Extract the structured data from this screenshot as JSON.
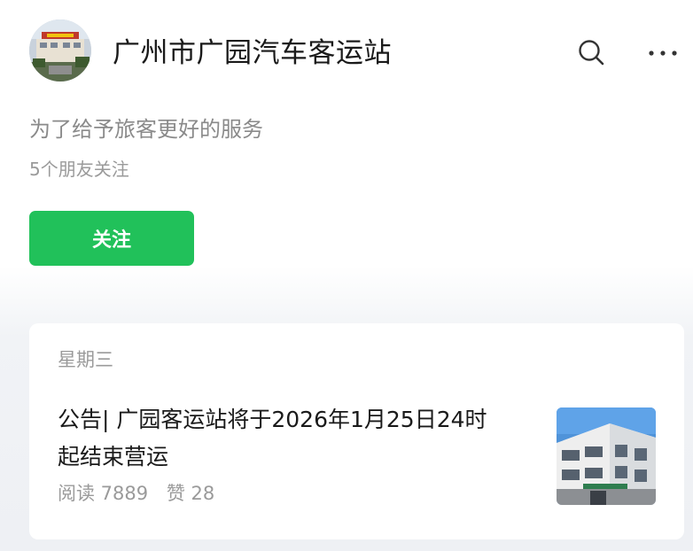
{
  "account": {
    "name": "广州市广园汽车客运站",
    "tagline": "为了给予旅客更好的服务",
    "followers": "5个朋友关注",
    "follow_label": "关注"
  },
  "header": {
    "search_icon": "search-icon",
    "more_icon": "more-icon"
  },
  "article": {
    "day": "星期三",
    "title_line1": "公告| 广园客运站将于2026年1月25日24时",
    "title_line2": "起结束营运",
    "reads": "阅读 7889",
    "likes": "赞 28"
  },
  "colors": {
    "accent": "#21c15a"
  }
}
